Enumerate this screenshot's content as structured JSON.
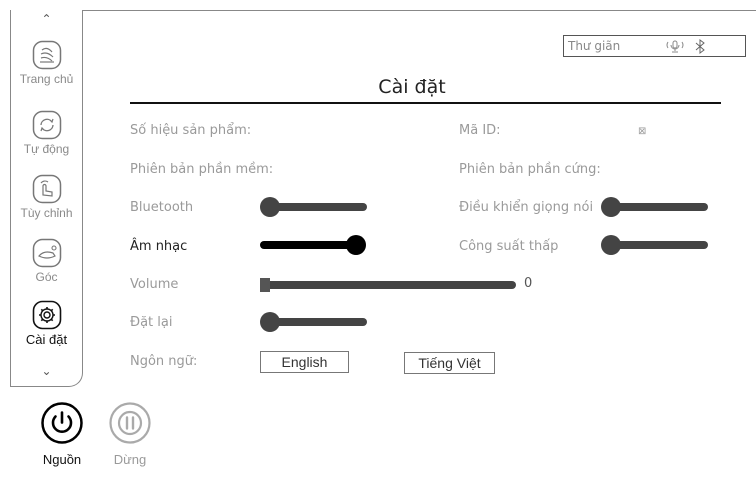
{
  "status": {
    "mode": "Thư giãn"
  },
  "sidebar": {
    "items": [
      {
        "label": "Trang chủ"
      },
      {
        "label": "Tự động"
      },
      {
        "label": "Tùy chỉnh"
      },
      {
        "label": "Góc"
      },
      {
        "label": "Cài đặt",
        "active": true
      }
    ]
  },
  "page": {
    "title": "Cài đặt"
  },
  "info": {
    "product_no_label": "Số hiệu sản phẩm:",
    "id_label": "Mã ID:",
    "id_value": "⊠",
    "software_label": "Phiên bản phần mềm:",
    "hardware_label": "Phiên bản phần cứng:"
  },
  "settings": {
    "bluetooth": {
      "label": "Bluetooth",
      "on": false
    },
    "voice_control": {
      "label": "Điều khiển giọng nói",
      "on": false
    },
    "music": {
      "label": "Âm nhạc",
      "on": true
    },
    "low_power": {
      "label": "Công suất thấp",
      "on": false
    },
    "volume": {
      "label": "Volume",
      "value": "0",
      "level": 0
    },
    "reset": {
      "label": "Đặt lại",
      "on": false
    },
    "language": {
      "label": "Ngôn ngữ:",
      "options": [
        "English",
        "Tiếng Việt"
      ]
    }
  },
  "footer": {
    "power_label": "Nguồn",
    "pause_label": "Dừng"
  },
  "colors": {
    "active": "#000000",
    "inactive": "#444444",
    "muted_text": "#9a9a9a"
  }
}
